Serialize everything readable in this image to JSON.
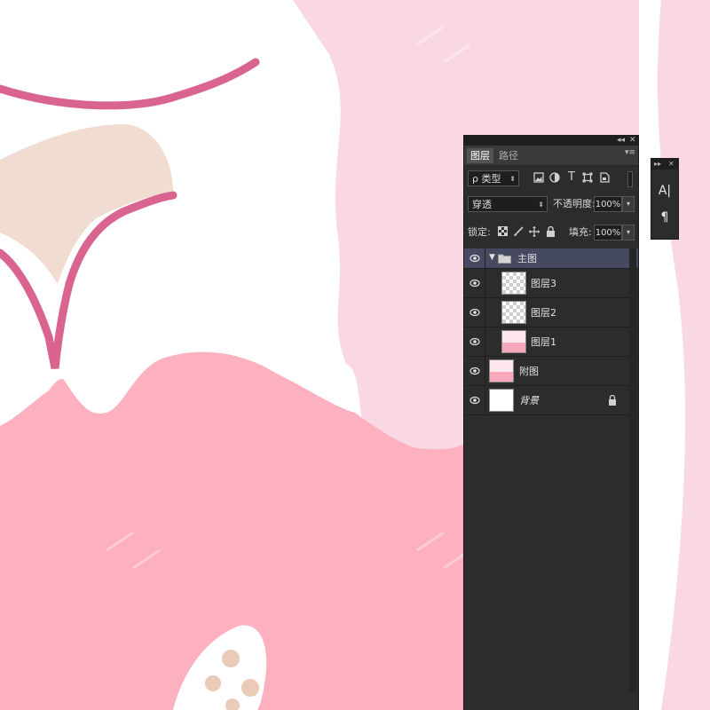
{
  "canvas": {
    "colors": {
      "white": "#ffffff",
      "light_pink": "#f9d8e3",
      "pink": "#fdb0c0",
      "accent_pink": "#d9648f",
      "beige": "#f0dcd0",
      "spots": "#e9cbb8"
    },
    "watermark_icon": "logo-watermark"
  },
  "layers_panel": {
    "top_controls": {
      "collapse": "◂◂",
      "close": "✕"
    },
    "tabs": [
      {
        "label": "图层",
        "active": true
      },
      {
        "label": "路径",
        "active": false
      }
    ],
    "filter": {
      "label": "ρ 类型",
      "icons": [
        "image-filter-icon",
        "adjustment-filter-icon",
        "type-filter-icon",
        "shape-filter-icon",
        "smart-object-filter-icon"
      ]
    },
    "blend_mode": "穿透",
    "opacity": {
      "label": "不透明度:",
      "value": "100%"
    },
    "lock": {
      "label": "锁定:"
    },
    "fill": {
      "label": "填充:",
      "value": "100%"
    },
    "layers": [
      {
        "name": "主图",
        "type": "group",
        "expanded": true,
        "visible": true
      },
      {
        "name": "图层3",
        "type": "layer",
        "thumb": "transparent",
        "visible": true
      },
      {
        "name": "图层2",
        "type": "layer",
        "thumb": "transparent",
        "visible": true
      },
      {
        "name": "图层1",
        "type": "layer",
        "thumb": "pink",
        "visible": true
      },
      {
        "name": "附图",
        "type": "layer",
        "thumb": "pink",
        "visible": true
      },
      {
        "name": "背景",
        "type": "background",
        "thumb": "white",
        "visible": true,
        "locked": true
      }
    ]
  },
  "side_panel": {
    "top_controls": {
      "expand": "▸▸",
      "close": "✕"
    },
    "buttons": [
      {
        "name": "character-panel-icon",
        "glyph": "A|"
      },
      {
        "name": "paragraph-panel-icon",
        "glyph": "¶"
      }
    ]
  }
}
